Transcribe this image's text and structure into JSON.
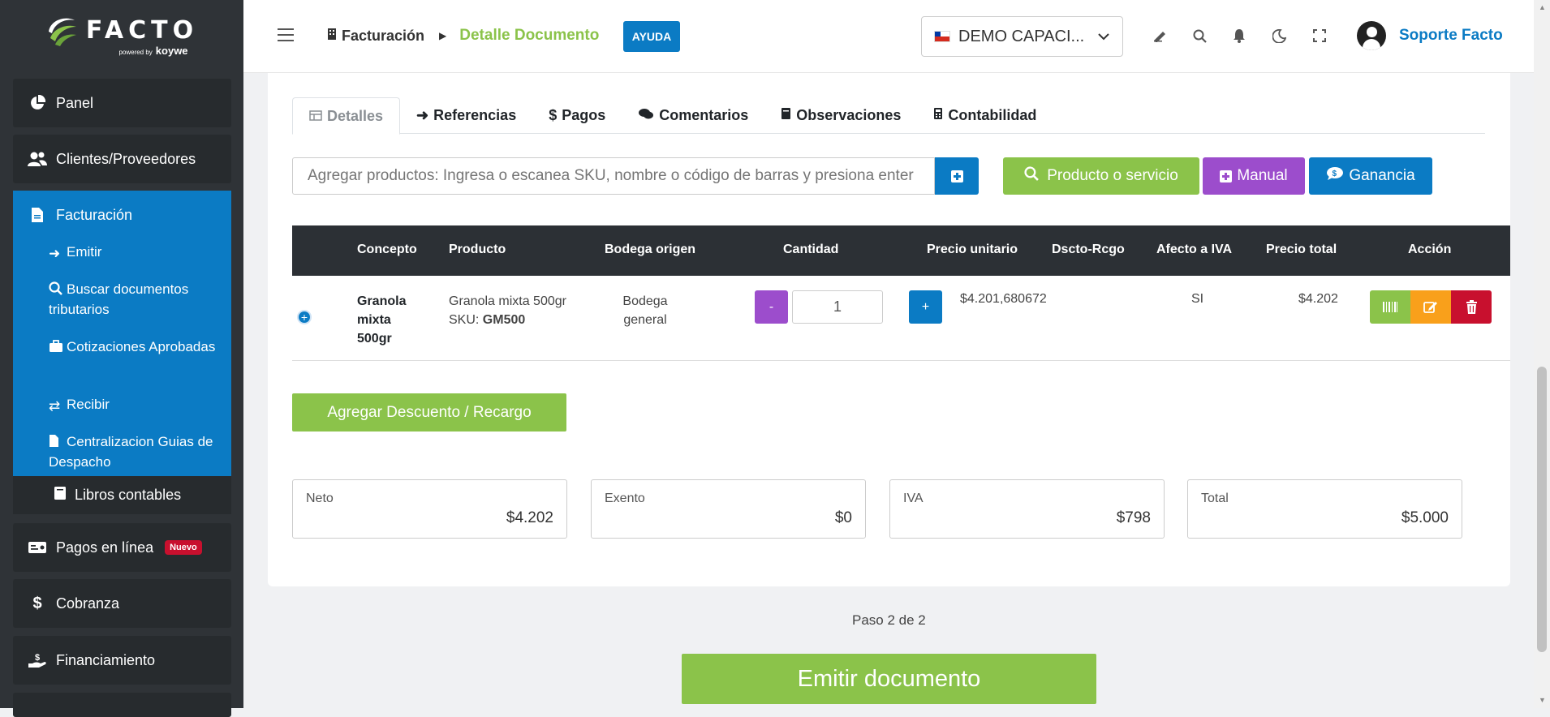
{
  "sidebar": {
    "logo_text": "FACTO",
    "powered_by": "powered by",
    "powered_brand": "koywe",
    "items": [
      {
        "label": "Panel",
        "icon": "pie-chart-icon"
      },
      {
        "label": "Clientes/Proveedores",
        "icon": "users-icon"
      },
      {
        "label": "Facturación",
        "icon": "file-icon"
      },
      {
        "label": "Pagos en línea",
        "icon": "payment-card-icon",
        "badge": "Nuevo"
      },
      {
        "label": "Cobranza",
        "icon": "dollar-icon"
      },
      {
        "label": "Financiamiento",
        "icon": "hand-money-icon"
      }
    ],
    "facturacion_sub": [
      {
        "label": "Emitir",
        "icon": "sign-in-icon"
      },
      {
        "label": "Buscar documentos tributarios",
        "icon": "search-icon"
      },
      {
        "label": "Cotizaciones Aprobadas",
        "icon": "briefcase-icon"
      },
      {
        "label": "Recibir",
        "icon": "shuffle-icon"
      },
      {
        "label": "Centralizacion Guias de Despacho",
        "icon": "file-icon"
      }
    ],
    "libros": "Libros contables"
  },
  "topbar": {
    "breadcrumb_parent": "Facturación",
    "breadcrumb_current": "Detalle Documento",
    "help_label": "AYUDA",
    "company": "DEMO CAPACI...",
    "user": "Soporte Facto"
  },
  "tabs": [
    {
      "label": "Detalles",
      "icon": "table-icon",
      "active": true
    },
    {
      "label": "Referencias",
      "icon": "sign-in-icon"
    },
    {
      "label": "Pagos",
      "icon": "dollar-icon"
    },
    {
      "label": "Comentarios",
      "icon": "comments-icon"
    },
    {
      "label": "Observaciones",
      "icon": "book-icon"
    },
    {
      "label": "Contabilidad",
      "icon": "calculator-icon"
    }
  ],
  "product_search": {
    "placeholder": "Agregar productos: Ingresa o escanea SKU, nombre o código de barras y presiona enter",
    "btn_product": "Producto o servicio",
    "btn_manual": "Manual",
    "btn_gain": "Ganancia"
  },
  "table": {
    "headers": [
      "Concepto",
      "Producto",
      "Bodega origen",
      "Cantidad",
      "Precio unitario",
      "Dscto-Rcgo",
      "Afecto a IVA",
      "Precio total",
      "Acción"
    ],
    "rows": [
      {
        "concepto": "Granola mixta 500gr",
        "producto": "Granola mixta 500gr",
        "sku_label": "SKU:",
        "sku": "GM500",
        "bodega": "Bodega general",
        "cantidad": "1",
        "precio_unitario": "$4.201,680672",
        "dscto": "",
        "afecto_iva": "SI",
        "precio_total": "$4.202"
      }
    ]
  },
  "discount_button": "Agregar Descuento / Recargo",
  "totals": {
    "neto_label": "Neto",
    "neto": "$4.202",
    "exento_label": "Exento",
    "exento": "$0",
    "iva_label": "IVA",
    "iva": "$798",
    "total_label": "Total",
    "total": "$5.000"
  },
  "step_text": "Paso 2 de 2",
  "emit_button": "Emitir documento",
  "colors": {
    "primary": "#0b7bc4",
    "success": "#8bc34a",
    "purple": "#9c4dcc",
    "danger": "#c8102e",
    "warning": "#f9a01b",
    "sidebar": "#2f3337"
  }
}
